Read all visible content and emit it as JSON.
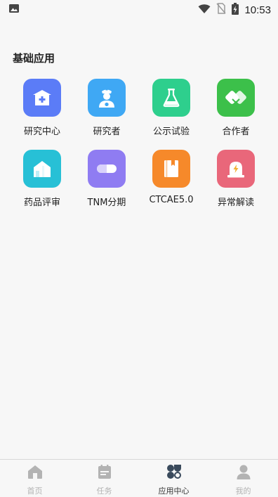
{
  "status_bar": {
    "time": "10:53",
    "icons": [
      "image-icon",
      "wifi-icon",
      "no-sim-icon",
      "battery-charging-icon"
    ]
  },
  "section": {
    "title": "基础应用"
  },
  "apps": [
    {
      "label": "研究中心",
      "icon": "hospital-icon",
      "color": "#5b7cf7"
    },
    {
      "label": "研究者",
      "icon": "doctor-icon",
      "color": "#3fa8f4"
    },
    {
      "label": "公示试验",
      "icon": "flask-icon",
      "color": "#2ecf8d"
    },
    {
      "label": "合作者",
      "icon": "handshake-icon",
      "color": "#3cc04a"
    },
    {
      "label": "药品评审",
      "icon": "building-icon",
      "color": "#27c0d6"
    },
    {
      "label": "TNM分期",
      "icon": "pill-icon",
      "color": "#8f7cf2"
    },
    {
      "label": "CTCAE5.0",
      "icon": "book-icon",
      "color": "#f6892a"
    },
    {
      "label": "异常解读",
      "icon": "alarm-icon",
      "color": "#e9677a"
    }
  ],
  "tabs": [
    {
      "label": "首页",
      "icon": "home-icon",
      "active": false
    },
    {
      "label": "任务",
      "icon": "calendar-icon",
      "active": false
    },
    {
      "label": "应用中心",
      "icon": "apps-icon",
      "active": true
    },
    {
      "label": "我的",
      "icon": "user-icon",
      "active": false
    }
  ],
  "colors": {
    "tab_inactive": "#b3b3b3",
    "tab_active": "#333333",
    "background": "#f7f7f7"
  }
}
